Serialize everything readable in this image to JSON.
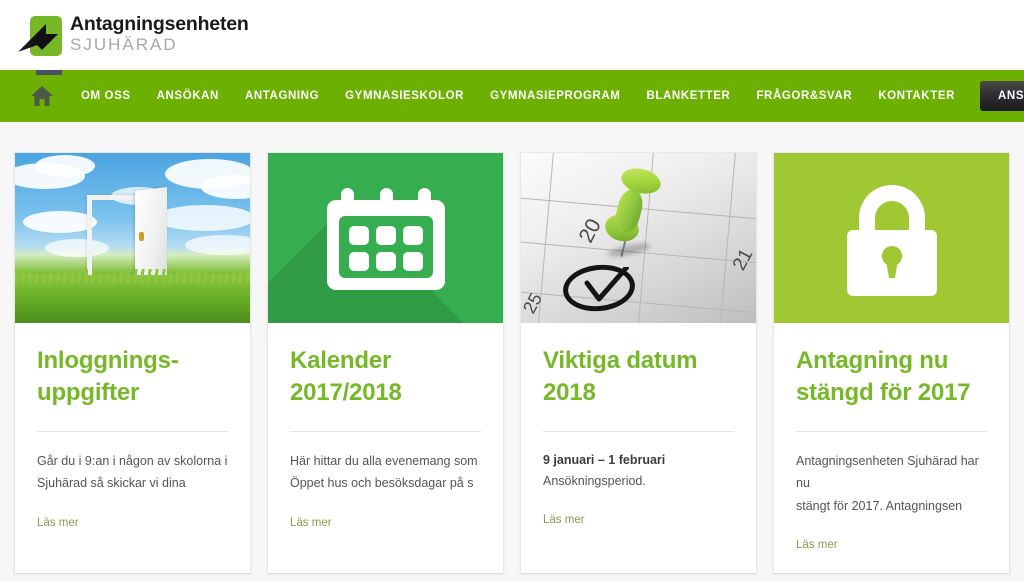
{
  "site": {
    "logo_title": "Antagningsenheten",
    "logo_subtitle": "SJUHÄRAD",
    "logo_icon": "cursor-arrow-square-logo"
  },
  "nav": {
    "home_icon": "home-icon",
    "search_icon": "search-icon",
    "items": [
      {
        "label": "OM OSS"
      },
      {
        "label": "ANSÖKAN"
      },
      {
        "label": "ANTAGNING"
      },
      {
        "label": "GYMNASIESKOLOR"
      },
      {
        "label": "GYMNASIEPROGRAM"
      },
      {
        "label": "BLANKETTER"
      },
      {
        "label": "FRÅGOR&SVAR"
      },
      {
        "label": "KONTAKTER"
      }
    ],
    "cta_label": "ANSÖKNINGSWEBB",
    "background_color": "#6cb002",
    "cta_color": "#2b2b2b"
  },
  "cards": [
    {
      "media_type": "photo-open-door",
      "title": "Inloggnings-\nuppgifter",
      "title_line1": "Inloggnings-",
      "title_line2": "uppgifter",
      "excerpt_line1": "Går du i 9:an i någon av skolorna i",
      "excerpt_line2": "Sjuhärad så skickar vi dina",
      "excerpt_bold": "",
      "read_more": "Läs mer",
      "media_color": "#7cc3ee"
    },
    {
      "media_type": "flat-calendar-icon",
      "title_line1": "Kalender",
      "title_line2": "2017/2018",
      "excerpt_line1": "Här hittar du alla evenemang som",
      "excerpt_line2": "Öppet hus och besöksdagar på s",
      "excerpt_bold": "",
      "read_more": "Läs mer",
      "media_color": "#36ae4f",
      "icon_name": "calendar-icon"
    },
    {
      "media_type": "photo-pin-calendar",
      "title_line1": "Viktiga datum",
      "title_line2": "2018",
      "excerpt_bold": "9 januari – 1 februari",
      "excerpt_line1": "Ansökningsperiod.",
      "excerpt_line2": "",
      "read_more": "Läs mer",
      "media_color": "#d4d4d4",
      "photo_numbers": [
        "20",
        "21",
        "25"
      ]
    },
    {
      "media_type": "flat-lock-icon",
      "title_line1": "Antagning nu",
      "title_line2": "stängd för 2017",
      "excerpt_line1": "Antagningsenheten Sjuhärad har nu",
      "excerpt_line2": "stängt för 2017. Antagningsen",
      "excerpt_bold": "",
      "read_more": "Läs mer",
      "media_color": "#a0c832",
      "icon_name": "lock-icon"
    }
  ],
  "theme": {
    "heading_green": "#76b828",
    "nav_green": "#6cb002",
    "page_background": "#f7f7f7",
    "read_more_color": "#8a9a4e"
  }
}
